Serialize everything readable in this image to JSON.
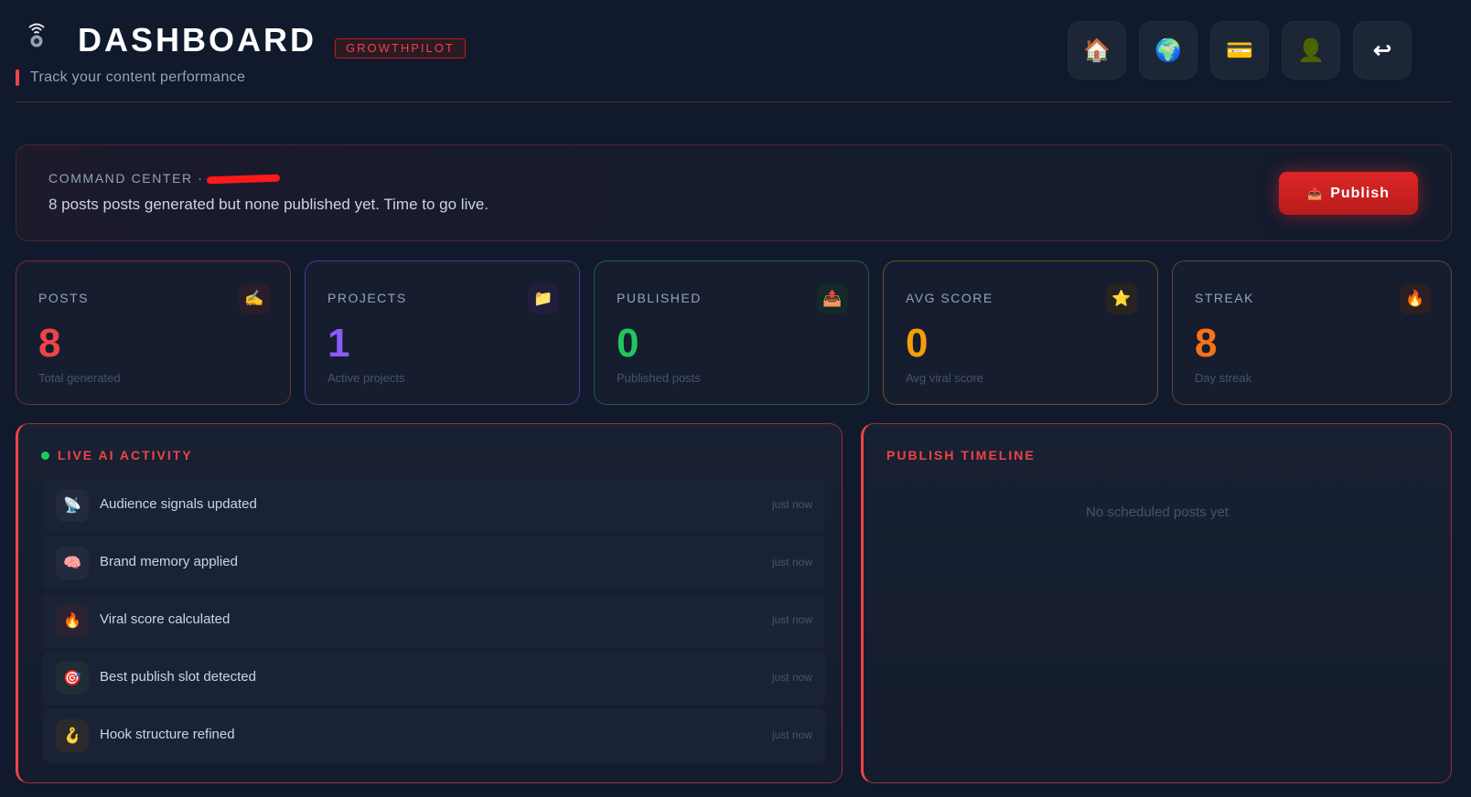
{
  "header": {
    "title": "DASHBOARD",
    "badge": "GROWTHPILOT",
    "subtitle": "Track your content performance",
    "logo_icon": "satellite-icon"
  },
  "nav": [
    {
      "name": "home",
      "icon": "🏠"
    },
    {
      "name": "globe",
      "icon": "🌍"
    },
    {
      "name": "billing",
      "icon": "💳"
    },
    {
      "name": "profile",
      "icon": "👤"
    },
    {
      "name": "logout",
      "icon": "↩"
    }
  ],
  "command": {
    "label": "COMMAND CENTER ·",
    "message": "8 posts posts generated but none published yet. Time to go live.",
    "publish_label": "Publish",
    "publish_icon": "📤"
  },
  "stats": [
    {
      "label": "POSTS",
      "value": "8",
      "sub": "Total generated",
      "icon": "✍️",
      "color": "#ef4444"
    },
    {
      "label": "PROJECTS",
      "value": "1",
      "sub": "Active projects",
      "icon": "📁",
      "color": "#8b5cf6"
    },
    {
      "label": "PUBLISHED",
      "value": "0",
      "sub": "Published posts",
      "icon": "📤",
      "color": "#22c55e"
    },
    {
      "label": "AVG SCORE",
      "value": "0",
      "sub": "Avg viral score",
      "icon": "⭐",
      "color": "#f59e0b"
    },
    {
      "label": "STREAK",
      "value": "8",
      "sub": "Day streak",
      "icon": "🔥",
      "color": "#f97316"
    }
  ],
  "activity": {
    "title": "LIVE AI ACTIVITY",
    "items": [
      {
        "text": "Audience signals updated",
        "time": "just now",
        "icon": "📡"
      },
      {
        "text": "Brand memory applied",
        "time": "just now",
        "icon": "🧠"
      },
      {
        "text": "Viral score calculated",
        "time": "just now",
        "icon": "🔥"
      },
      {
        "text": "Best publish slot detected",
        "time": "just now",
        "icon": "🎯"
      },
      {
        "text": "Hook structure refined",
        "time": "just now",
        "icon": "🪝"
      }
    ]
  },
  "timeline": {
    "title": "PUBLISH TIMELINE",
    "empty": "No scheduled posts yet"
  },
  "colors": {
    "accent": "#ef4444",
    "background": "#111a2c",
    "live": "#22c55e"
  }
}
